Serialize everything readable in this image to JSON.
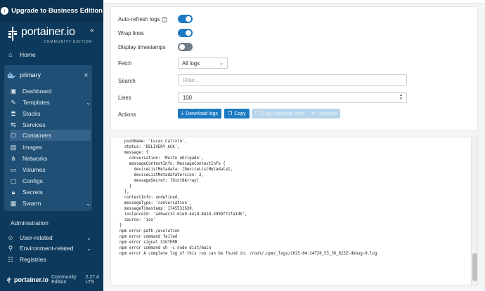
{
  "sidebar": {
    "upgrade_label": "Upgrade to Business Edition",
    "brand_name": "portainer.io",
    "brand_sub": "COMMUNITY EDITION",
    "home": "Home",
    "environment": "primary",
    "items": [
      {
        "label": "Dashboard",
        "icon": "dashboard-icon"
      },
      {
        "label": "Templates",
        "icon": "templates-icon"
      },
      {
        "label": "Stacks",
        "icon": "stacks-icon"
      },
      {
        "label": "Services",
        "icon": "services-icon"
      },
      {
        "label": "Containers",
        "icon": "containers-icon"
      },
      {
        "label": "Images",
        "icon": "images-icon"
      },
      {
        "label": "Networks",
        "icon": "networks-icon"
      },
      {
        "label": "Volumes",
        "icon": "volumes-icon"
      },
      {
        "label": "Configs",
        "icon": "configs-icon"
      },
      {
        "label": "Secrets",
        "icon": "secrets-icon"
      },
      {
        "label": "Swarm",
        "icon": "swarm-icon"
      }
    ],
    "admin_title": "Administration",
    "admin_items": [
      {
        "label": "User-related"
      },
      {
        "label": "Environment-related"
      },
      {
        "label": "Registries"
      }
    ],
    "footer_brand": "portainer.io",
    "footer_edition": "Community Edition",
    "footer_version": "2.27.4 LTS"
  },
  "settings": {
    "auto_refresh_label": "Auto-refresh logs",
    "wrap_lines_label": "Wrap lines",
    "timestamps_label": "Display timestamps",
    "fetch_label": "Fetch",
    "fetch_value": "All logs",
    "search_label": "Search",
    "search_placeholder": "Filter...",
    "lines_label": "Lines",
    "lines_value": "100",
    "actions_label": "Actions",
    "download_label": "Download logs",
    "copy_label": "Copy",
    "copy_selected_label": "Copy selected lines",
    "unselect_label": "Unselect"
  },
  "logs": [
    "  },",
    "  pushName: 'Lucas Calixto',",
    "  status: 'DELIVERY_ACK',",
    "  message: {",
    "    conversation: 'Muito obrigado',",
    "    messageContextInfo: MessageContextInfo {",
    "      deviceListMetadata: [DeviceListMetadata],",
    "      deviceListMetadataVersion: 2,",
    "      messageSecret: [Uint8Array]",
    "    }",
    "  },",
    "  contextInfo: undefined,",
    "  messageType: 'conversation',",
    "  messageTimestamp: 1745532630,",
    "  instanceId: 'a40a4c32-01e9-441d-8418-399bf71fa1db',",
    "  source: 'ios'",
    "}",
    "npm error path /evolution",
    "npm error command failed",
    "npm error signal SIGTERM",
    "npm error command sh -c node dist/main",
    "npm error A complete log of this run can be found in: /root/.npm/_logs/2025-04-24T20_53_36_623Z-debug-0.log"
  ]
}
